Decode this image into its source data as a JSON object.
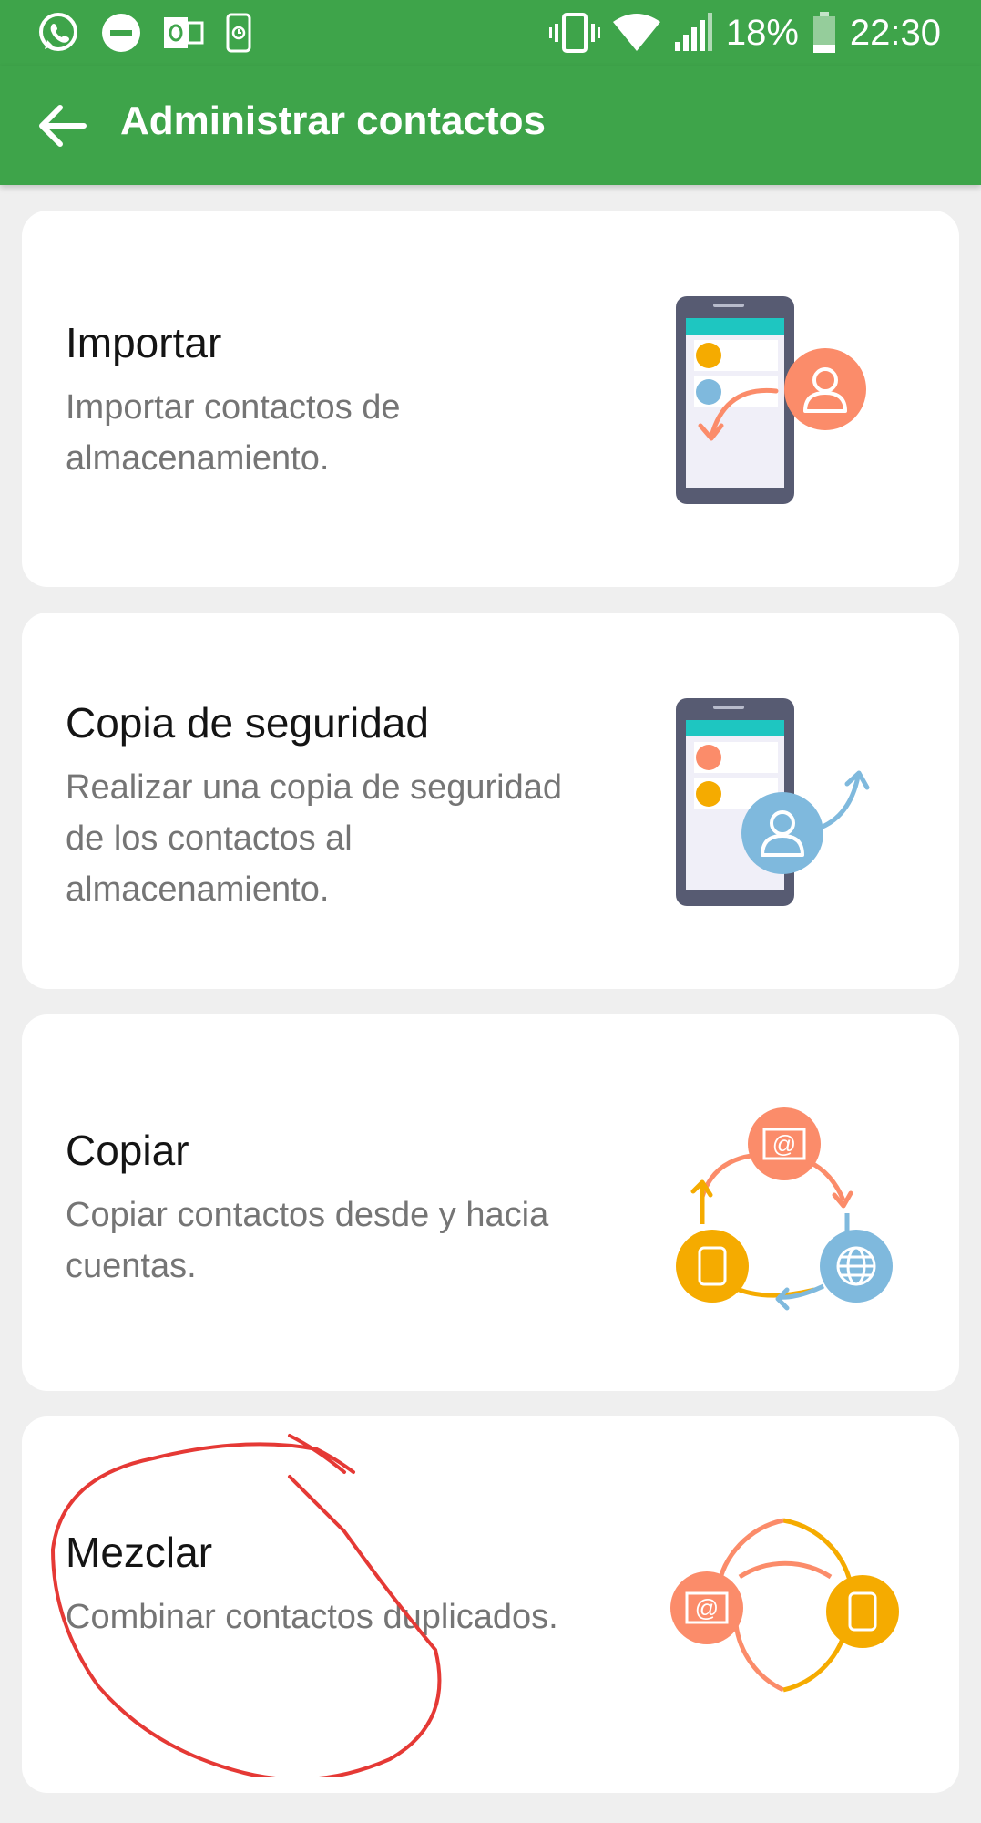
{
  "status_bar": {
    "battery": "18%",
    "time": "22:30",
    "icons_left": [
      "whatsapp-icon",
      "do-not-disturb-icon",
      "outlook-icon",
      "phone-clock-icon"
    ],
    "icons_right": [
      "vibrate-icon",
      "wifi-icon",
      "signal-icon",
      "battery-icon"
    ]
  },
  "app_bar": {
    "title": "Administrar contactos",
    "back_icon": "arrow-back-icon"
  },
  "options": [
    {
      "title": "Importar",
      "description": "Importar contactos de almacenamiento.",
      "icon": "import-contacts-illustration"
    },
    {
      "title": "Copia de seguridad",
      "description": "Realizar una copia de seguridad de los contactos al almacenamiento.",
      "icon": "backup-contacts-illustration"
    },
    {
      "title": "Copiar",
      "description": "Copiar contactos desde y hacia cuentas.",
      "icon": "copy-contacts-illustration"
    },
    {
      "title": "Mezclar",
      "description": "Combinar contactos duplicados.",
      "icon": "merge-contacts-illustration"
    }
  ],
  "colors": {
    "app_bar": "#3ea44a",
    "orange": "#fb8c6a",
    "yellow": "#f5ab00",
    "blue": "#7fb9dd",
    "phone_body": "#575b72",
    "teal": "#1ec6c1",
    "annotation_red": "#e53935"
  }
}
